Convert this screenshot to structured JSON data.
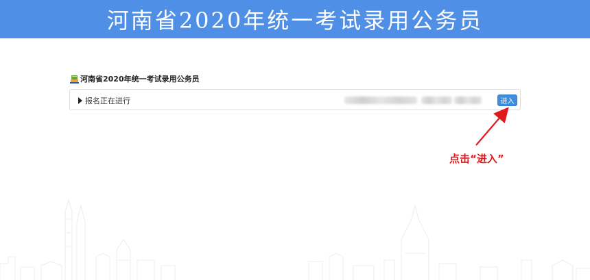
{
  "header": {
    "title": "河南省2020年统一考试录用公务员"
  },
  "section": {
    "title": "河南省2020年统一考试录用公务员",
    "icon": "exam-logo-icon"
  },
  "exam_row": {
    "status": "报名正在进行",
    "enter_label": "进入"
  },
  "annotation": {
    "text": "点击“进入”"
  },
  "colors": {
    "header_bg": "#4f8fe6",
    "button_bg": "#3d8ee0",
    "annotation": "#e0191c"
  }
}
